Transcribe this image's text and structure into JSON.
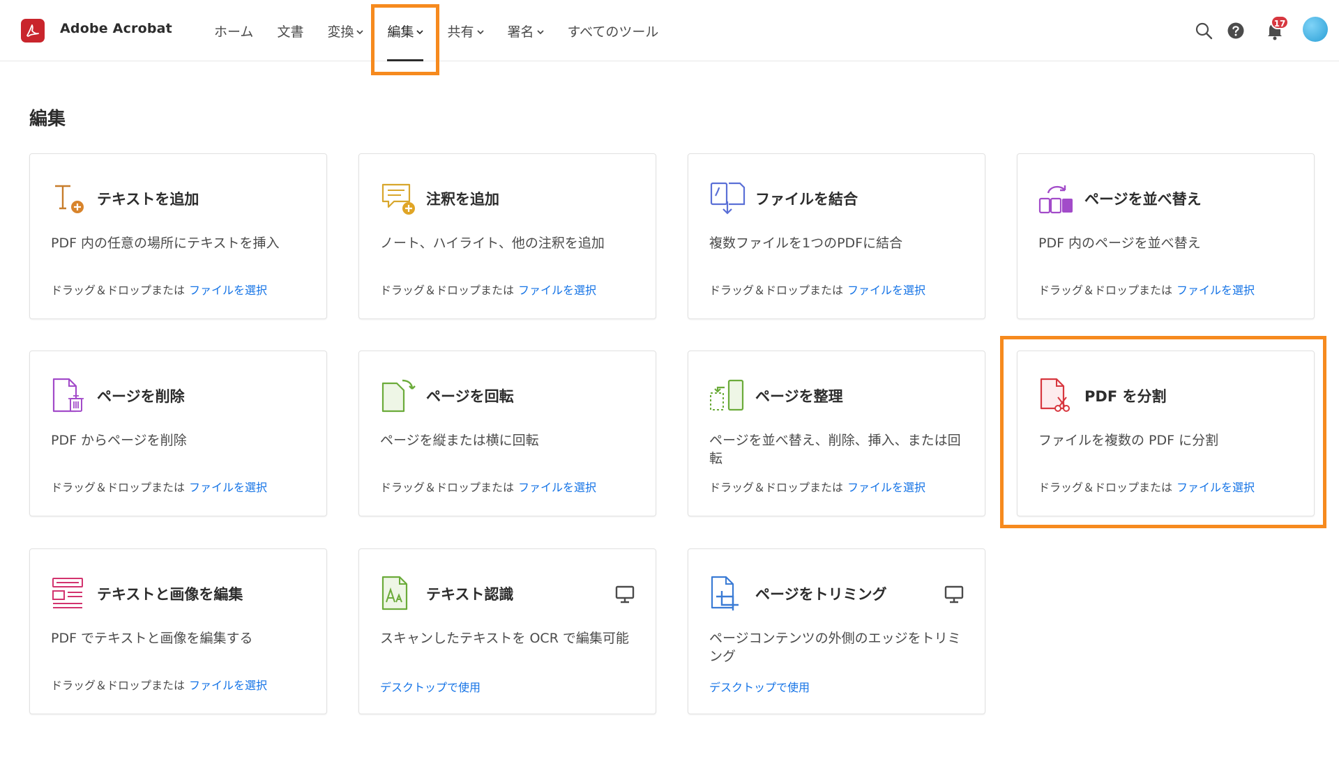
{
  "app": {
    "title": "Adobe Acrobat",
    "brand_color": "#c9252c",
    "accent_color": "#1473e6",
    "highlight_color": "#f68a1e"
  },
  "nav": {
    "items": [
      {
        "label": "ホーム",
        "has_dropdown": false
      },
      {
        "label": "文書",
        "has_dropdown": false
      },
      {
        "label": "変換",
        "has_dropdown": true
      },
      {
        "label": "編集",
        "has_dropdown": true,
        "active": true
      },
      {
        "label": "共有",
        "has_dropdown": true
      },
      {
        "label": "署名",
        "has_dropdown": true
      },
      {
        "label": "すべてのツール",
        "has_dropdown": false
      }
    ]
  },
  "header_icons": {
    "search": "search-icon",
    "help": "help-icon",
    "notifications": "bell-icon",
    "notification_count": "17",
    "avatar": "avatar"
  },
  "page": {
    "title": "編集"
  },
  "common": {
    "drop_text": "ドラッグ＆ドロップまたは",
    "select_file": "ファイルを選択",
    "desktop_use": "デスクトップで使用"
  },
  "cards": [
    {
      "title": "テキストを追加",
      "desc": "PDF 内の任意の場所にテキストを挿入",
      "icon": "add-text-icon",
      "desktop": false
    },
    {
      "title": "注釈を追加",
      "desc": "ノート、ハイライト、他の注釈を追加",
      "icon": "add-comment-icon",
      "desktop": false
    },
    {
      "title": "ファイルを結合",
      "desc": "複数ファイルを1つのPDFに結合",
      "icon": "combine-files-icon",
      "desktop": false
    },
    {
      "title": "ページを並べ替え",
      "desc": "PDF 内のページを並べ替え",
      "icon": "reorder-pages-icon",
      "desktop": false
    },
    {
      "title": "ページを削除",
      "desc": "PDF からページを削除",
      "icon": "delete-pages-icon",
      "desktop": false
    },
    {
      "title": "ページを回転",
      "desc": "ページを縦または横に回転",
      "icon": "rotate-pages-icon",
      "desktop": false
    },
    {
      "title": "ページを整理",
      "desc": "ページを並べ替え、削除、挿入、または回転",
      "icon": "organize-pages-icon",
      "desktop": false
    },
    {
      "title": "PDF を分割",
      "desc": "ファイルを複数の PDF に分割",
      "icon": "split-pdf-icon",
      "desktop": false,
      "highlighted": true
    },
    {
      "title": "テキストと画像を編集",
      "desc": "PDF でテキストと画像を編集する",
      "icon": "edit-text-image-icon",
      "desktop": false
    },
    {
      "title": "テキスト認識",
      "desc": "スキャンしたテキストを OCR で編集可能",
      "icon": "ocr-icon",
      "desktop": true
    },
    {
      "title": "ページをトリミング",
      "desc": "ページコンテンツの外側のエッジをトリミング",
      "icon": "crop-pages-icon",
      "desktop": true
    }
  ]
}
